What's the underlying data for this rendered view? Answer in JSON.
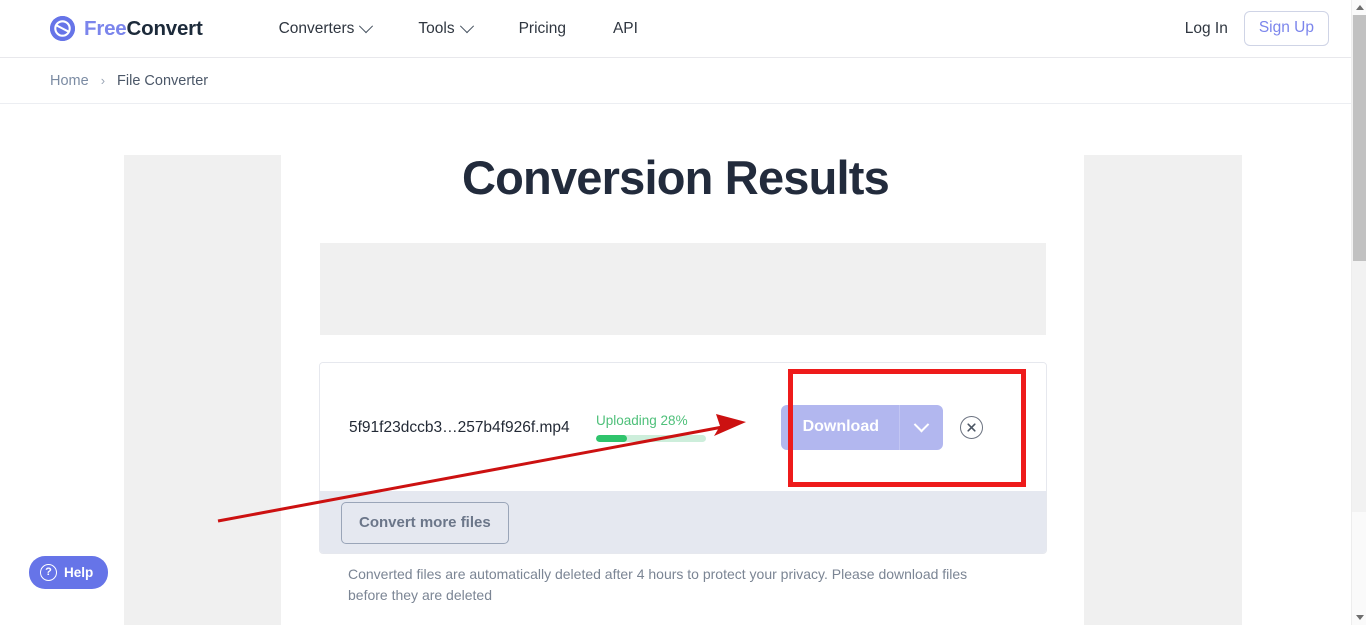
{
  "site": {
    "brand_first": "Free",
    "brand_second": "Convert",
    "logo_icon": "circular-refresh-icon"
  },
  "header": {
    "nav": [
      {
        "label": "Converters",
        "has_caret": true,
        "caret_icon": "chevron-down-icon"
      },
      {
        "label": "Tools",
        "has_caret": true,
        "caret_icon": "chevron-down-icon"
      },
      {
        "label": "Pricing",
        "has_caret": false
      },
      {
        "label": "API",
        "has_caret": false
      }
    ],
    "login_label": "Log In",
    "signup_label": "Sign Up",
    "signup_color": "#7b85ec"
  },
  "breadcrumb": {
    "home_label": "Home",
    "separator": "›",
    "current_label": "File Converter"
  },
  "main": {
    "page_title": "Conversion Results",
    "notice": "Converted files are automatically deleted after 4 hours to protect your privacy. Please download files before they are deleted"
  },
  "file_row": {
    "file_name": "5f91f23dccb3…257b4f926f.mp4",
    "status_label": "Uploading 28%",
    "status_color": "#4fc07a",
    "progress_percent": 28,
    "progress_fill_color": "#2fc46c",
    "progress_track_color": "#cdeedb",
    "download_label": "Download",
    "download_caret_icon": "chevron-down-icon",
    "download_button_color": "#b2b7ef",
    "remove_icon": "circle-x-icon"
  },
  "card_footer": {
    "convert_more_label": "Convert more files"
  },
  "help_widget": {
    "label": "Help",
    "icon": "question-circle-icon",
    "color": "#6674e8"
  },
  "annotations": {
    "highlight_color": "#ee1b1b",
    "arrow_color": "#cc1111",
    "box_target": "download-button-group",
    "arrow_icon": "arrow-pointer"
  },
  "scrollbar": {
    "up_arrow_icon": "triangle-up-icon",
    "down_arrow_icon": "triangle-down-icon",
    "thumb_icon": "scrollbar-thumb"
  }
}
